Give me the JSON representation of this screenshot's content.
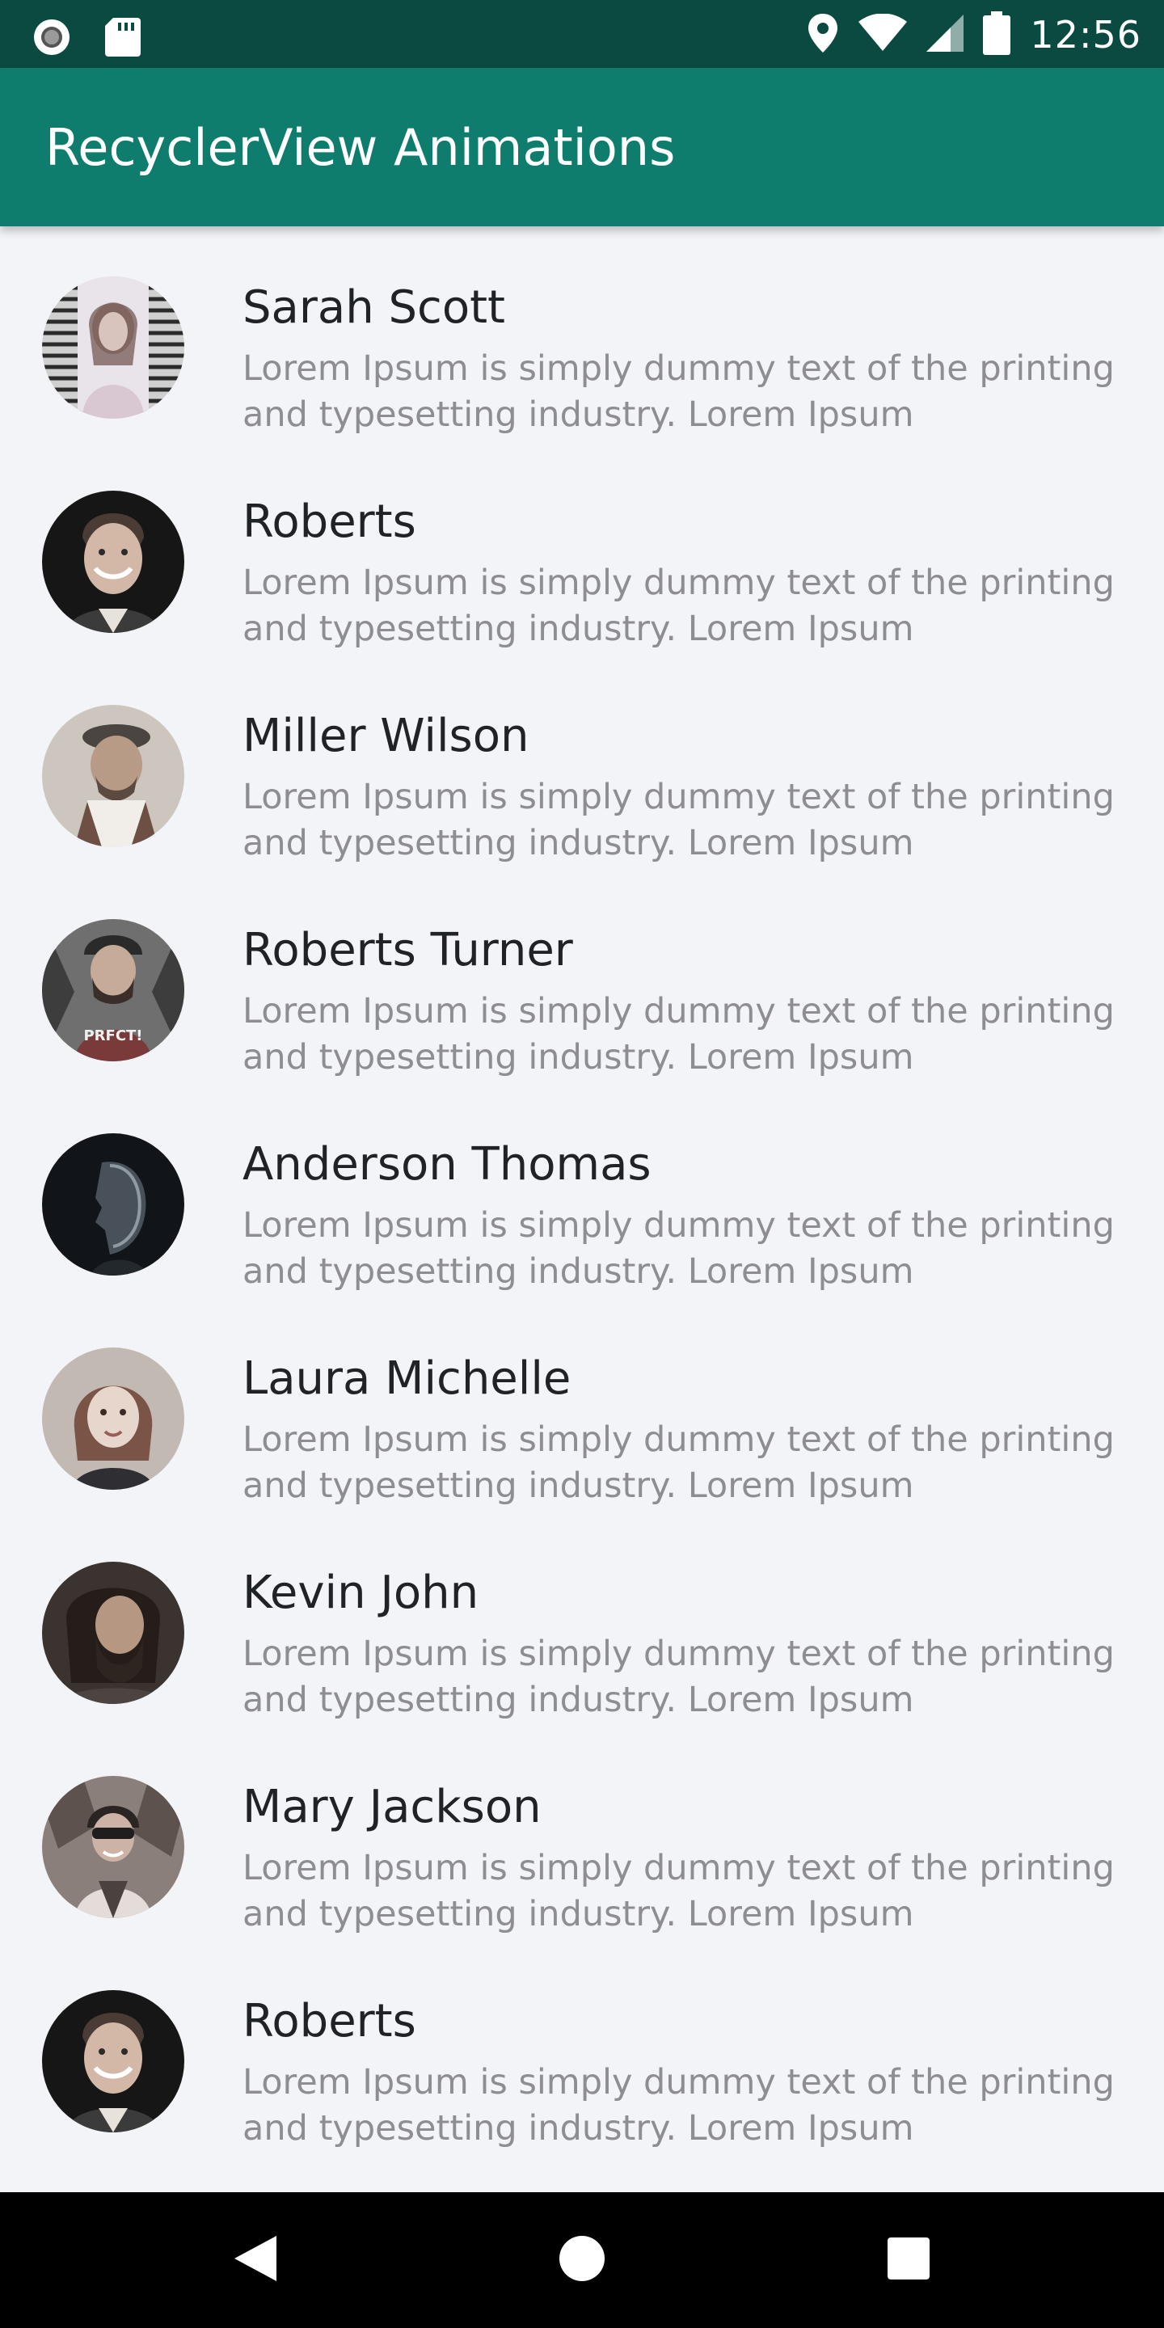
{
  "status_bar": {
    "time": "12:56",
    "icons": [
      "record-icon",
      "sd-card-icon",
      "location-icon",
      "wifi-icon",
      "signal-icon",
      "battery-icon"
    ]
  },
  "app_bar": {
    "title": "RecyclerView Animations",
    "color": "#0f7d6e"
  },
  "list": {
    "items": [
      {
        "name": "Sarah Scott",
        "description": "Lorem Ipsum is simply dummy text of the printing and typesetting industry. Lorem Ipsum"
      },
      {
        "name": "Roberts",
        "description": "Lorem Ipsum is simply dummy text of the printing and typesetting industry. Lorem Ipsum"
      },
      {
        "name": "Miller Wilson",
        "description": "Lorem Ipsum is simply dummy text of the printing and typesetting industry. Lorem Ipsum"
      },
      {
        "name": "Roberts Turner",
        "description": "Lorem Ipsum is simply dummy text of the printing and typesetting industry. Lorem Ipsum"
      },
      {
        "name": "Anderson Thomas",
        "description": "Lorem Ipsum is simply dummy text of the printing and typesetting industry. Lorem Ipsum"
      },
      {
        "name": "Laura Michelle",
        "description": "Lorem Ipsum is simply dummy text of the printing and typesetting industry. Lorem Ipsum"
      },
      {
        "name": "Kevin John",
        "description": "Lorem Ipsum is simply dummy text of the printing and typesetting industry. Lorem Ipsum"
      },
      {
        "name": "Mary Jackson",
        "description": "Lorem Ipsum is simply dummy text of the printing and typesetting industry. Lorem Ipsum"
      },
      {
        "name": "Roberts",
        "description": "Lorem Ipsum is simply dummy text of the printing and typesetting industry. Lorem Ipsum"
      }
    ]
  },
  "nav_bar": {
    "buttons": [
      "back-icon",
      "home-icon",
      "recents-icon"
    ]
  }
}
